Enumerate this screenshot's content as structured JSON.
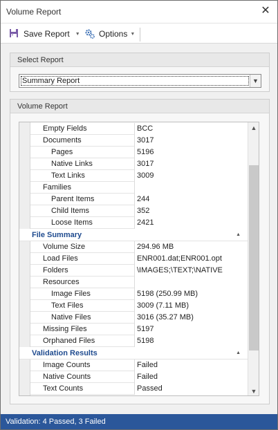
{
  "window": {
    "title": "Volume Report"
  },
  "toolbar": {
    "save_label": "Save Report",
    "options_label": "Options"
  },
  "select_report": {
    "header": "Select Report",
    "selected": "Summary Report"
  },
  "volume_report": {
    "header": "Volume Report",
    "rows_top": [
      {
        "label": "Empty Fields",
        "value": "BCC",
        "level": 1
      },
      {
        "label": "Documents",
        "value": "3017",
        "level": 1
      },
      {
        "label": "Pages",
        "value": "5196",
        "level": 2
      },
      {
        "label": "Native Links",
        "value": "3017",
        "level": 2
      },
      {
        "label": "Text Links",
        "value": "3009",
        "level": 2
      },
      {
        "label": "Families",
        "value": "",
        "level": 1
      },
      {
        "label": "Parent Items",
        "value": "244",
        "level": 2
      },
      {
        "label": "Child Items",
        "value": "352",
        "level": 2
      },
      {
        "label": "Loose Items",
        "value": "2421",
        "level": 2
      }
    ],
    "file_summary": {
      "label": "File Summary",
      "rows": [
        {
          "label": "Volume Size",
          "value": "294.96 MB",
          "level": 1
        },
        {
          "label": "Load Files",
          "value": "ENR001.dat;ENR001.opt",
          "level": 1
        },
        {
          "label": "Folders",
          "value": "\\IMAGES;\\TEXT;\\NATIVE",
          "level": 1
        },
        {
          "label": "Resources",
          "value": "",
          "level": 1
        },
        {
          "label": "Image Files",
          "value": "5198 (250.99 MB)",
          "level": 2
        },
        {
          "label": "Text Files",
          "value": "3009 (7.11 MB)",
          "level": 2
        },
        {
          "label": "Native Files",
          "value": "3016 (35.27 MB)",
          "level": 2
        },
        {
          "label": "Missing Files",
          "value": "5197",
          "level": 1
        },
        {
          "label": "Orphaned Files",
          "value": "5198",
          "level": 1
        }
      ]
    },
    "validation_results": {
      "label": "Validation Results",
      "rows": [
        {
          "label": "Image Counts",
          "value": "Failed",
          "level": 1
        },
        {
          "label": "Native Counts",
          "value": "Failed",
          "level": 1
        },
        {
          "label": "Text Counts",
          "value": "Passed",
          "level": 1
        }
      ]
    }
  },
  "status": {
    "text": "Validation: 4 Passed, 3 Failed"
  },
  "colors": {
    "accent": "#2b579a",
    "category_text": "#1f4b8f"
  }
}
